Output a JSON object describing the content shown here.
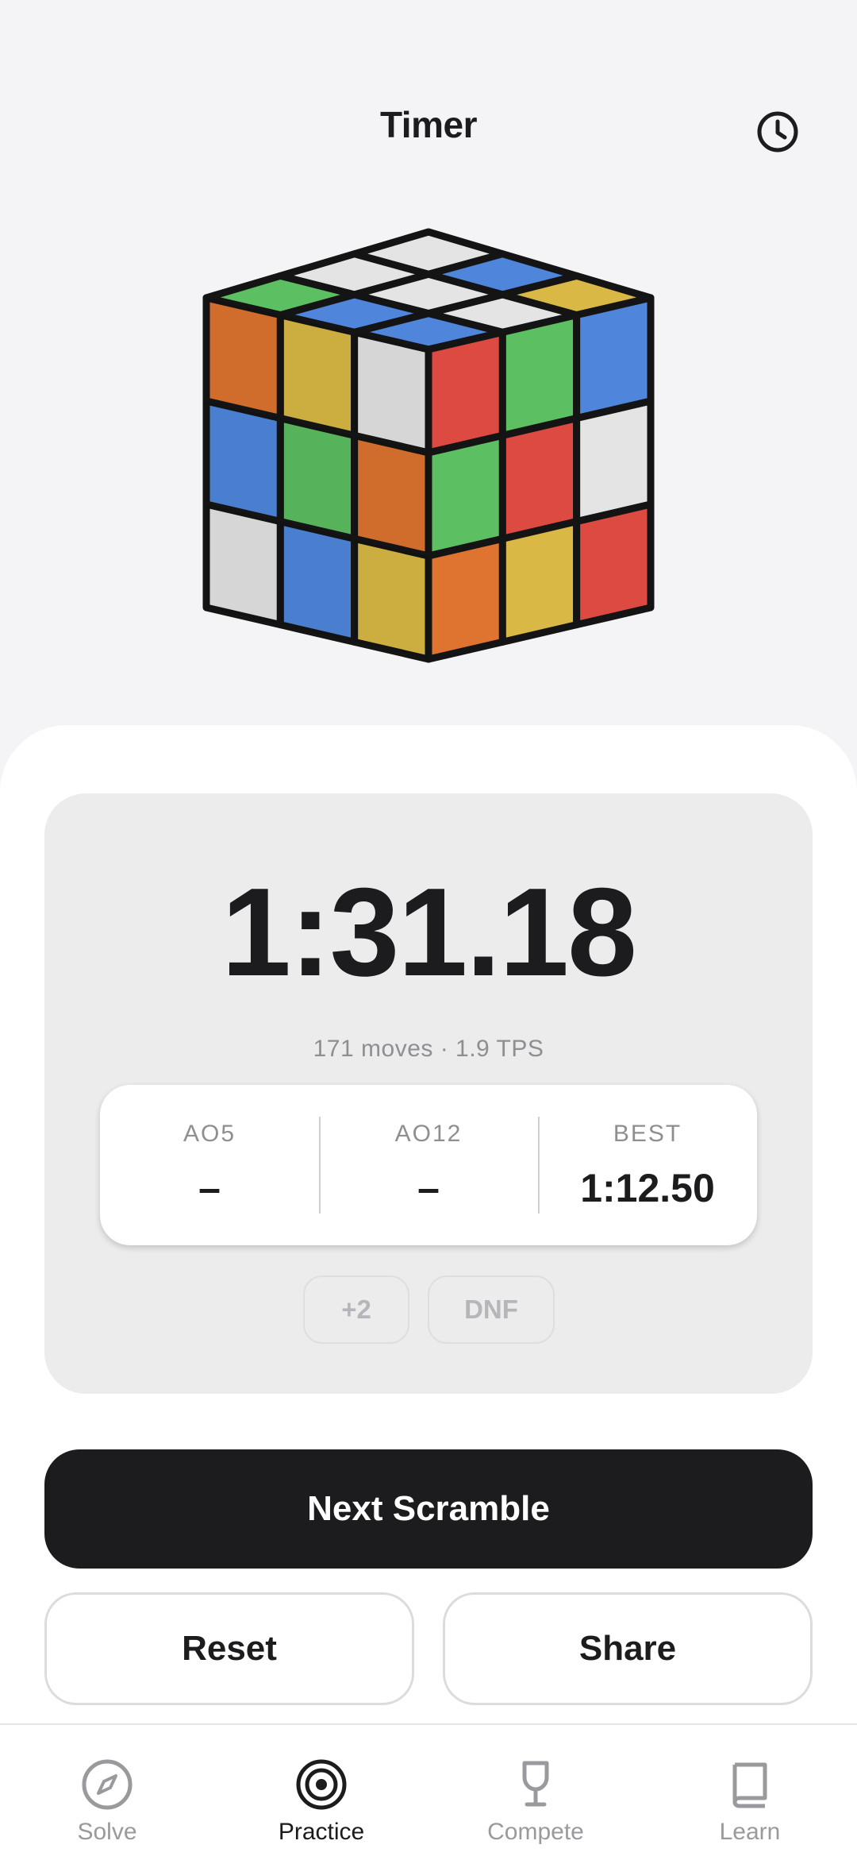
{
  "header": {
    "title": "Timer",
    "history_icon": "clock-icon"
  },
  "cube": {
    "colors": {
      "white": "#e4e4e4",
      "blue": "#4f86dc",
      "yellow": "#d9b845",
      "green": "#5cbf62",
      "red": "#dc4a42",
      "orange": "#de7430"
    },
    "top": [
      "white",
      "blue",
      "yellow",
      "white",
      "white",
      "white",
      "green",
      "blue",
      "blue"
    ],
    "left": [
      "orange",
      "yellow",
      "white",
      "blue",
      "green",
      "orange",
      "white",
      "blue",
      "yellow"
    ],
    "right": [
      "red",
      "green",
      "blue",
      "green",
      "red",
      "white",
      "orange",
      "yellow",
      "red"
    ]
  },
  "timer": {
    "value": "1:31.18",
    "meta": "171 moves · 1.9 TPS"
  },
  "stats": [
    {
      "label": "AO5",
      "value": "–"
    },
    {
      "label": "AO12",
      "value": "–"
    },
    {
      "label": "BEST",
      "value": "1:12.50"
    }
  ],
  "penalties": {
    "plus_two": "+2",
    "dnf": "DNF"
  },
  "actions": {
    "next_scramble": "Next Scramble",
    "reset": "Reset",
    "share": "Share"
  },
  "tabs": [
    {
      "label": "Solve",
      "icon": "compass-icon",
      "active": false
    },
    {
      "label": "Practice",
      "icon": "target-icon",
      "active": true
    },
    {
      "label": "Compete",
      "icon": "trophy-icon",
      "active": false
    },
    {
      "label": "Learn",
      "icon": "book-icon",
      "active": false
    }
  ]
}
